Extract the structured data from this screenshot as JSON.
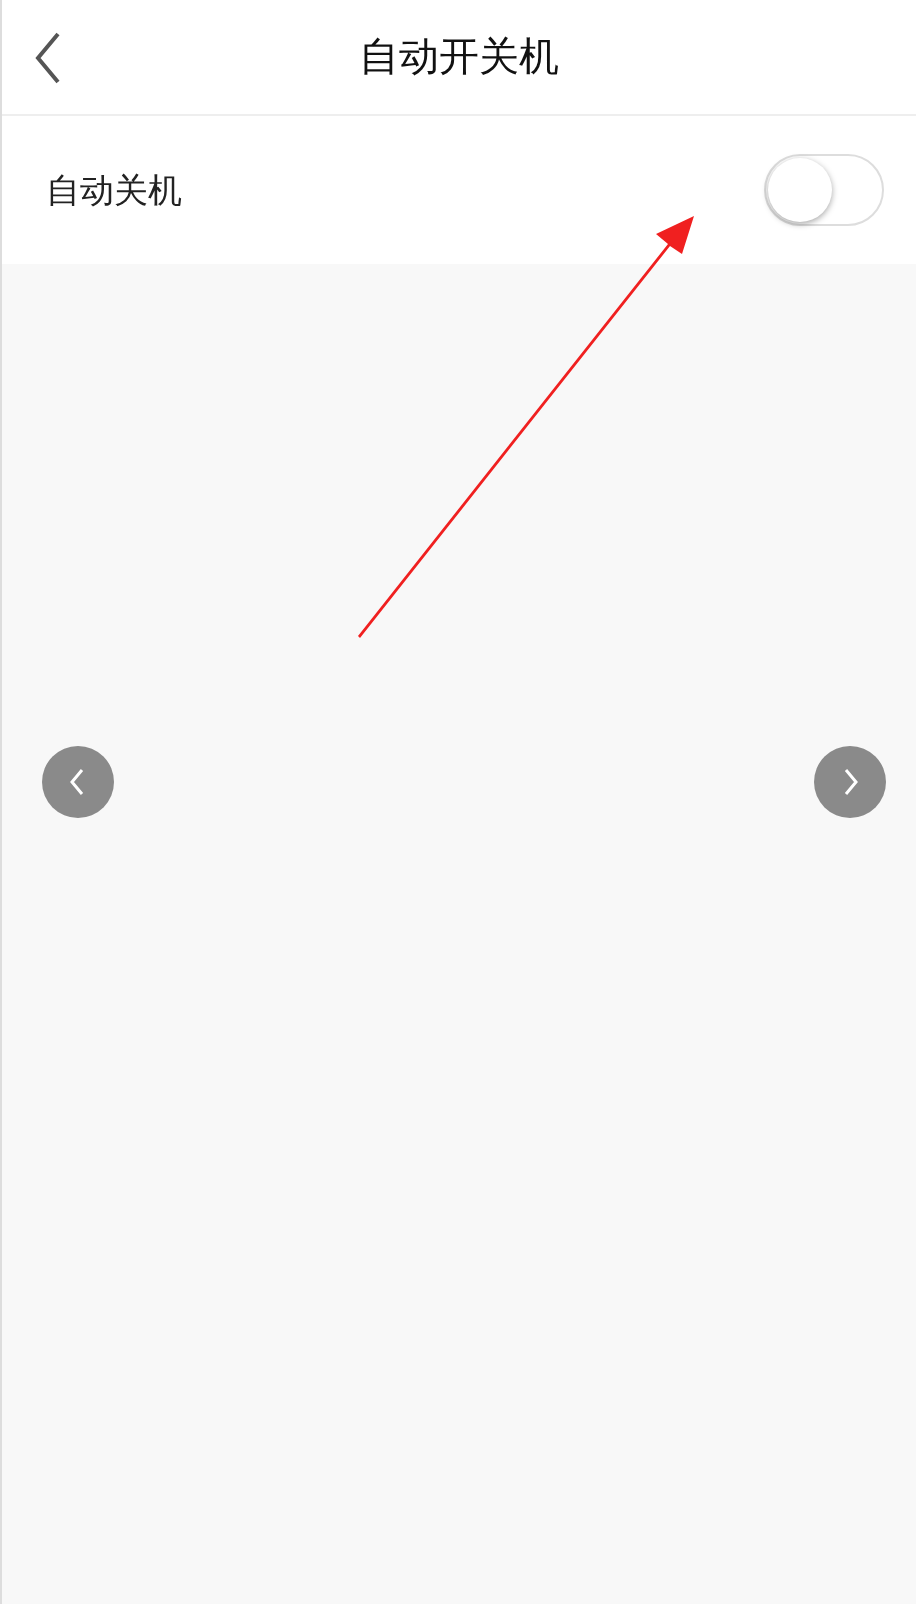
{
  "header": {
    "title": "自动开关机"
  },
  "settings": [
    {
      "kind": "toggle",
      "label": "自动关机",
      "on": false
    }
  ]
}
